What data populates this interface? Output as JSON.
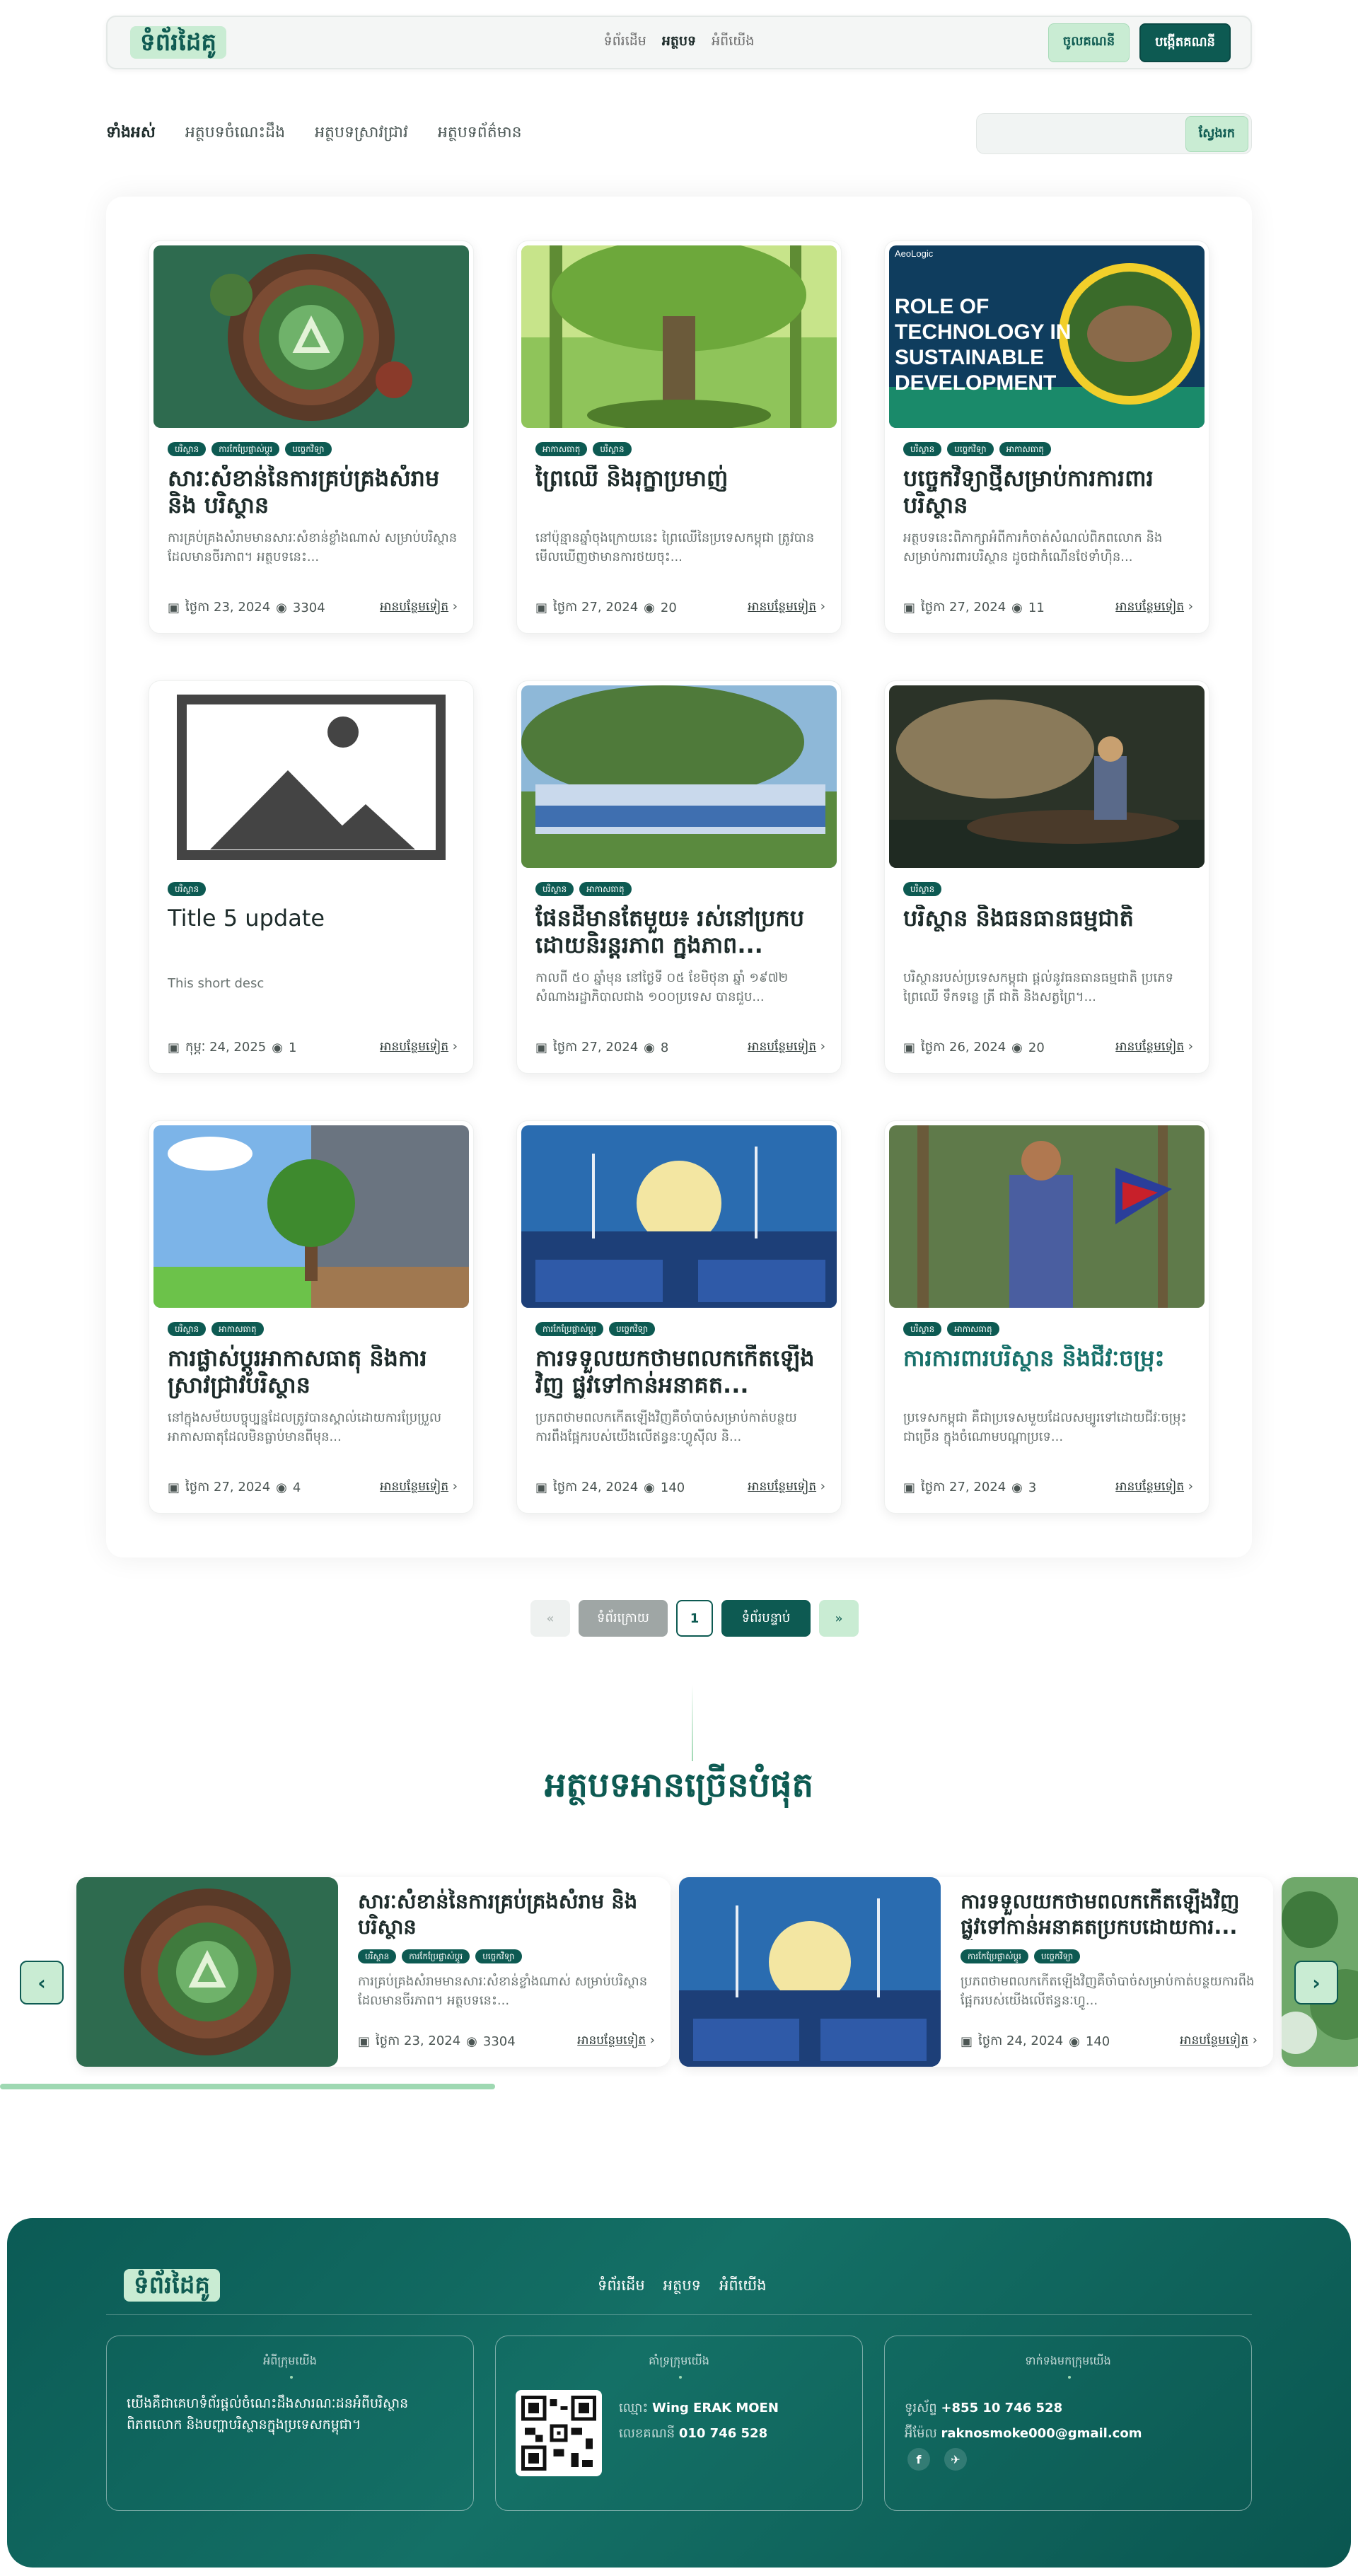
{
  "header": {
    "logo": "ទំព័រដៃគូ",
    "nav": [
      "ទំព័រដើម",
      "អត្ថបទ",
      "អំពីយើង"
    ],
    "login": "ចូលគណនី",
    "register": "បង្កើតគណនី"
  },
  "filters": {
    "tabs": [
      "ទាំងអស់",
      "អត្ថបទចំណេះដឹង",
      "អត្ថបទស្រាវជ្រាវ",
      "អត្ថបទព័ត៌មាន"
    ],
    "search_placeholder": "",
    "search_button": "ស្វែងរក"
  },
  "cards": [
    {
      "tags": [
        "បរិស្ថាន",
        "ការកែប្រែផ្លាស់ប្តូរ",
        "បច្ចេកវិទ្យា"
      ],
      "title": "សារៈសំខាន់នៃការគ្រប់គ្រងសំរាម និង បរិស្ថាន",
      "desc": "ការគ្រប់គ្រងសំរាមមានសារៈសំខាន់ខ្លាំងណាស់ សម្រាប់បរិស្ថានដែលមានចីរភាព។ អត្ថបទនេះ...",
      "date": "ថ្ងៃកា 23, 2024",
      "views": "3304",
      "read": "អានបន្ថែមទៀត"
    },
    {
      "tags": [
        "អាកាសធាតុ",
        "បរិស្ថាន"
      ],
      "title": "ព្រៃឈើ និងរុក្ខាប្រមាញ់",
      "desc": "នៅប៉ុន្មានឆ្នាំចុងក្រោយនេះ ព្រៃឈើនៃប្រទេសកម្ពុជា ត្រូវបានមើលឃើញថាមានការថយចុះ...",
      "date": "ថ្ងៃកា 27, 2024",
      "views": "20",
      "read": "អានបន្ថែមទៀត"
    },
    {
      "tags": [
        "បរិស្ថាន",
        "បច្ចេកវិទ្យា",
        "អាកាសធាតុ"
      ],
      "title": "បច្ចេកវិទ្យាថ្មីសម្រាប់ការការពារ បរិស្ថាន",
      "desc": "អត្ថបទនេះពិភាក្សាអំពីការកំចាត់សំណល់ពិភពលោក និងសម្រាប់ការពារបរិស្ថាន ដូចជាកំណើនថែទាំហ៊ិន...",
      "date": "ថ្ងៃកា 27, 2024",
      "views": "11",
      "read": "អានបន្ថែមទៀត",
      "img_text": [
        "ROLE OF",
        "TECHNOLOGY IN",
        "SUSTAINABLE",
        "DEVELOPMENT"
      ],
      "img_brand": "AeoLogic"
    },
    {
      "tags": [
        "បរិស្ថាន"
      ],
      "title": "Title 5 update",
      "desc": "This short desc",
      "date": "កុម្ភៈ 24, 2025",
      "views": "1",
      "read": "អានបន្ថែមទៀត"
    },
    {
      "tags": [
        "បរិស្ថាន",
        "អាកាសធាតុ"
      ],
      "title": "ផែនដីមានតែមួយ៖ រស់នៅប្រកបដោយនិរន្តរភាព ក្នុងភាព...",
      "desc": "កាលពី ៥០ ឆ្នាំមុន នៅថ្ងៃទី ០៥ ខែមិថុនា ឆ្នាំ ១៩៧២ សំណាងរដ្ឋាភិបាលជាង ១០០ប្រទេស បានជួប...",
      "date": "ថ្ងៃកា 27, 2024",
      "views": "8",
      "read": "អានបន្ថែមទៀត"
    },
    {
      "tags": [
        "បរិស្ថាន"
      ],
      "title": "បរិស្ថាន និងធនធានធម្មជាតិ",
      "desc": "បរិស្ថានរបស់ប្រទេសកម្ពុជា ផ្តល់នូវធនធានធម្មជាតិ ប្រភេទ ព្រៃឈើ ទឹកទន្លេ ត្រី ជាតិ និងសត្វព្រៃ។...",
      "date": "ថ្ងៃកា 26, 2024",
      "views": "20",
      "read": "អានបន្ថែមទៀត"
    },
    {
      "tags": [
        "បរិស្ថាន",
        "អាកាសធាតុ"
      ],
      "title": "ការផ្លាស់ប្តូរអាកាសធាតុ និងការស្រាវជ្រាវបរិស្ថាន",
      "desc": "នៅក្នុងសម័យបច្ចុប្បន្នដែលត្រូវបានស្គាល់ដោយការប្រែប្រួលអាកាសធាតុដែលមិនធ្លាប់មានពីមុន...",
      "date": "ថ្ងៃកា 27, 2024",
      "views": "4",
      "read": "អានបន្ថែមទៀត"
    },
    {
      "tags": [
        "ការកែប្រែផ្លាស់ប្តូរ",
        "បច្ចេកវិទ្យា"
      ],
      "title": "ការទទួលយកថាមពលកកើតឡើងវិញ ផ្លូវទៅកាន់អនាគត...",
      "desc": "ប្រភពថាមពលកកើតឡើងវិញគឺចាំបាច់សម្រាប់កាត់បន្ថយការពឹងផ្អែករបស់យើងលើឥន្ធនៈហ្វូស៊ីល និ...",
      "date": "ថ្ងៃកា 24, 2024",
      "views": "140",
      "read": "អានបន្ថែមទៀត"
    },
    {
      "tags": [
        "បរិស្ថាន",
        "អាកាសធាតុ"
      ],
      "title": "ការការពារបរិស្ថាន និងជីវៈចម្រុះ",
      "desc": "ប្រទេសកម្ពុជា គឺជាប្រទេសមួយដែលសម្បូរទៅដោយជីវៈចម្រុះជាច្រើន ក្នុងចំណោមបណ្តាប្រទេ...",
      "date": "ថ្ងៃកា 27, 2024",
      "views": "3",
      "read": "អានបន្ថែមទៀត"
    }
  ],
  "pagination": {
    "first": "«",
    "prev": "ទំព័រក្រោយ",
    "page": "1",
    "next": "ទំព័របន្ទាប់",
    "last": "»"
  },
  "popular": {
    "title": "អត្ថបទអានច្រើនបំផុត",
    "items": [
      {
        "title": "សារៈសំខាន់នៃការគ្រប់គ្រងសំរាម និង បរិស្ថាន",
        "tags": [
          "បរិស្ថាន",
          "ការកែប្រែផ្លាស់ប្តូរ",
          "បច្ចេកវិទ្យា"
        ],
        "desc": "ការគ្រប់គ្រងសំរាមមានសារៈសំខាន់ខ្លាំងណាស់ សម្រាប់បរិស្ថានដែលមានចីរភាព។ អត្ថបទនេះ...",
        "date": "ថ្ងៃកា 23, 2024",
        "views": "3304",
        "read": "អានបន្ថែមទៀត"
      },
      {
        "title": "ការទទួលយកថាមពលកកើតឡើងវិញ ផ្លូវទៅកាន់អនាគតប្រកបដោយការ...",
        "tags": [
          "ការកែប្រែផ្លាស់ប្តូរ",
          "បច្ចេកវិទ្យា"
        ],
        "desc": "ប្រភពថាមពលកកើតឡើងវិញគឺចាំបាច់សម្រាប់កាត់បន្ថយការពឹងផ្អែករបស់យើងលើឥន្ធនៈហ្វូ...",
        "date": "ថ្ងៃកា 24, 2024",
        "views": "140",
        "read": "អានបន្ថែមទៀត"
      }
    ],
    "prev_arrow": "‹",
    "next_arrow": "›"
  },
  "footer": {
    "logo": "ទំព័រដៃគូ",
    "nav": [
      "ទំព័រដើម",
      "អត្ថបទ",
      "អំពីយើង"
    ],
    "about_title": "អំពីក្រុមយើង",
    "about_text": "យើងគឺជាគេហទំព័រផ្តល់ចំណេះដឹងសារណៈដនអំពីបរិស្ថានពិភពលោក និងបញ្ហាបរិស្ថានក្នុងប្រទេសកម្ពុជា។",
    "support_title": "គាំទ្រក្រុមយើង",
    "bank_name_label": "ឈ្មោះ",
    "bank_name": "Wing ERAK MOEN",
    "bank_acct_label": "លេខគណនី",
    "bank_acct": "010 746 528",
    "contact_title": "ទាក់ទងមកក្រុមយើង",
    "phone_label": "ទូរស័ព្ទ",
    "phone": "+855 10 746 528",
    "email_label": "អ៊ីម៉ែល",
    "email": "raknosmoke000@gmail.com",
    "social": [
      "f",
      "✈"
    ]
  },
  "colors": {
    "primary": "#0d5a52",
    "mint": "#c9ecd3",
    "accent_title": "#16706a"
  }
}
